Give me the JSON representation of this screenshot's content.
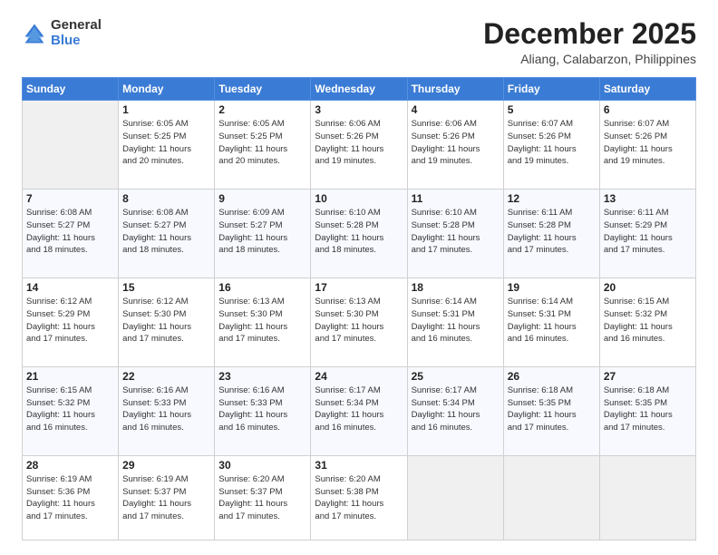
{
  "header": {
    "logo_general": "General",
    "logo_blue": "Blue",
    "title": "December 2025",
    "subtitle": "Aliang, Calabarzon, Philippines"
  },
  "calendar": {
    "weekdays": [
      "Sunday",
      "Monday",
      "Tuesday",
      "Wednesday",
      "Thursday",
      "Friday",
      "Saturday"
    ],
    "weeks": [
      [
        {
          "day": "",
          "info": ""
        },
        {
          "day": "1",
          "info": "Sunrise: 6:05 AM\nSunset: 5:25 PM\nDaylight: 11 hours\nand 20 minutes."
        },
        {
          "day": "2",
          "info": "Sunrise: 6:05 AM\nSunset: 5:25 PM\nDaylight: 11 hours\nand 20 minutes."
        },
        {
          "day": "3",
          "info": "Sunrise: 6:06 AM\nSunset: 5:26 PM\nDaylight: 11 hours\nand 19 minutes."
        },
        {
          "day": "4",
          "info": "Sunrise: 6:06 AM\nSunset: 5:26 PM\nDaylight: 11 hours\nand 19 minutes."
        },
        {
          "day": "5",
          "info": "Sunrise: 6:07 AM\nSunset: 5:26 PM\nDaylight: 11 hours\nand 19 minutes."
        },
        {
          "day": "6",
          "info": "Sunrise: 6:07 AM\nSunset: 5:26 PM\nDaylight: 11 hours\nand 19 minutes."
        }
      ],
      [
        {
          "day": "7",
          "info": "Sunrise: 6:08 AM\nSunset: 5:27 PM\nDaylight: 11 hours\nand 18 minutes."
        },
        {
          "day": "8",
          "info": "Sunrise: 6:08 AM\nSunset: 5:27 PM\nDaylight: 11 hours\nand 18 minutes."
        },
        {
          "day": "9",
          "info": "Sunrise: 6:09 AM\nSunset: 5:27 PM\nDaylight: 11 hours\nand 18 minutes."
        },
        {
          "day": "10",
          "info": "Sunrise: 6:10 AM\nSunset: 5:28 PM\nDaylight: 11 hours\nand 18 minutes."
        },
        {
          "day": "11",
          "info": "Sunrise: 6:10 AM\nSunset: 5:28 PM\nDaylight: 11 hours\nand 17 minutes."
        },
        {
          "day": "12",
          "info": "Sunrise: 6:11 AM\nSunset: 5:28 PM\nDaylight: 11 hours\nand 17 minutes."
        },
        {
          "day": "13",
          "info": "Sunrise: 6:11 AM\nSunset: 5:29 PM\nDaylight: 11 hours\nand 17 minutes."
        }
      ],
      [
        {
          "day": "14",
          "info": "Sunrise: 6:12 AM\nSunset: 5:29 PM\nDaylight: 11 hours\nand 17 minutes."
        },
        {
          "day": "15",
          "info": "Sunrise: 6:12 AM\nSunset: 5:30 PM\nDaylight: 11 hours\nand 17 minutes."
        },
        {
          "day": "16",
          "info": "Sunrise: 6:13 AM\nSunset: 5:30 PM\nDaylight: 11 hours\nand 17 minutes."
        },
        {
          "day": "17",
          "info": "Sunrise: 6:13 AM\nSunset: 5:30 PM\nDaylight: 11 hours\nand 17 minutes."
        },
        {
          "day": "18",
          "info": "Sunrise: 6:14 AM\nSunset: 5:31 PM\nDaylight: 11 hours\nand 16 minutes."
        },
        {
          "day": "19",
          "info": "Sunrise: 6:14 AM\nSunset: 5:31 PM\nDaylight: 11 hours\nand 16 minutes."
        },
        {
          "day": "20",
          "info": "Sunrise: 6:15 AM\nSunset: 5:32 PM\nDaylight: 11 hours\nand 16 minutes."
        }
      ],
      [
        {
          "day": "21",
          "info": "Sunrise: 6:15 AM\nSunset: 5:32 PM\nDaylight: 11 hours\nand 16 minutes."
        },
        {
          "day": "22",
          "info": "Sunrise: 6:16 AM\nSunset: 5:33 PM\nDaylight: 11 hours\nand 16 minutes."
        },
        {
          "day": "23",
          "info": "Sunrise: 6:16 AM\nSunset: 5:33 PM\nDaylight: 11 hours\nand 16 minutes."
        },
        {
          "day": "24",
          "info": "Sunrise: 6:17 AM\nSunset: 5:34 PM\nDaylight: 11 hours\nand 16 minutes."
        },
        {
          "day": "25",
          "info": "Sunrise: 6:17 AM\nSunset: 5:34 PM\nDaylight: 11 hours\nand 16 minutes."
        },
        {
          "day": "26",
          "info": "Sunrise: 6:18 AM\nSunset: 5:35 PM\nDaylight: 11 hours\nand 17 minutes."
        },
        {
          "day": "27",
          "info": "Sunrise: 6:18 AM\nSunset: 5:35 PM\nDaylight: 11 hours\nand 17 minutes."
        }
      ],
      [
        {
          "day": "28",
          "info": "Sunrise: 6:19 AM\nSunset: 5:36 PM\nDaylight: 11 hours\nand 17 minutes."
        },
        {
          "day": "29",
          "info": "Sunrise: 6:19 AM\nSunset: 5:37 PM\nDaylight: 11 hours\nand 17 minutes."
        },
        {
          "day": "30",
          "info": "Sunrise: 6:20 AM\nSunset: 5:37 PM\nDaylight: 11 hours\nand 17 minutes."
        },
        {
          "day": "31",
          "info": "Sunrise: 6:20 AM\nSunset: 5:38 PM\nDaylight: 11 hours\nand 17 minutes."
        },
        {
          "day": "",
          "info": ""
        },
        {
          "day": "",
          "info": ""
        },
        {
          "day": "",
          "info": ""
        }
      ]
    ]
  }
}
